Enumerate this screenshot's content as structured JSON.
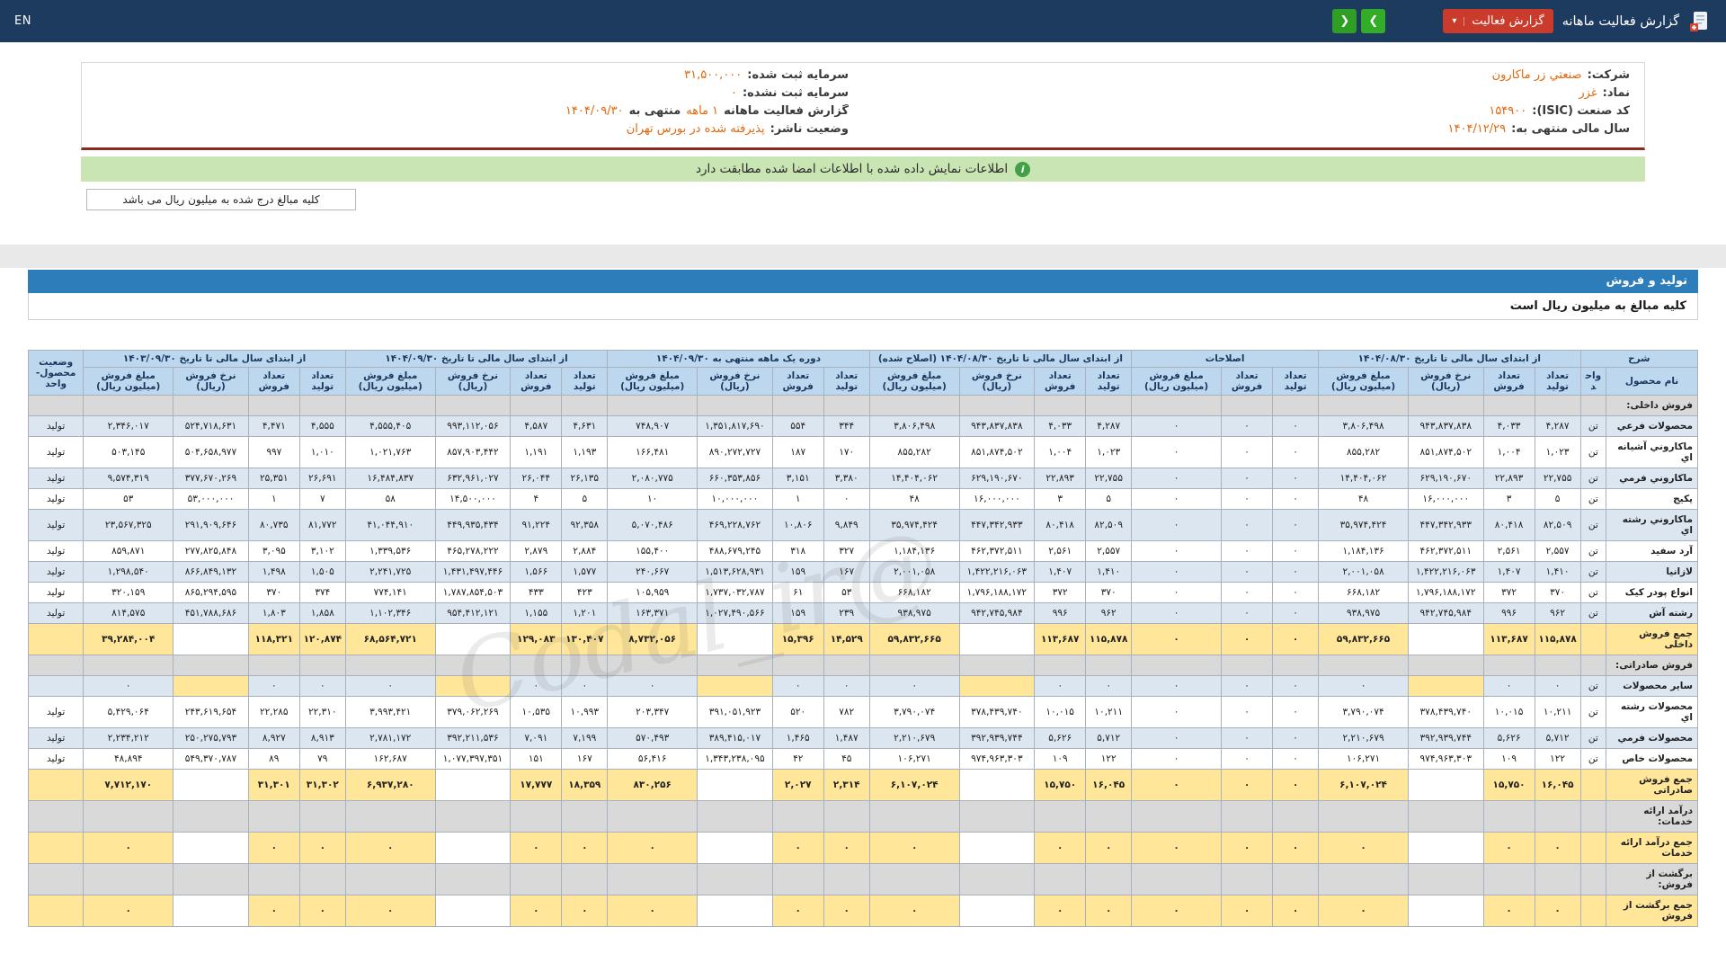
{
  "topbar": {
    "en_label": "EN",
    "title": "گزارش فعالیت ماهانه",
    "report_button_label": "گزارش فعالیت",
    "chevron_down_icon": "▾",
    "nav_forward_icon": "❯",
    "nav_back_icon": "❮"
  },
  "company_info": {
    "col_right": [
      {
        "label": "شرکت:",
        "value": "صنعتي زر ماکارون"
      },
      {
        "label": "نماد:",
        "value": "غزر"
      },
      {
        "label": "کد صنعت (ISIC):",
        "value": "۱۵۴۹۰۰"
      },
      {
        "label": "سال مالی منتهی به:",
        "value": "۱۴۰۴/۱۲/۲۹"
      }
    ],
    "col_left": [
      {
        "label": "سرمایه ثبت شده:",
        "value": "۳۱,۵۰۰,۰۰۰"
      },
      {
        "label": "سرمایه ثبت نشده:",
        "value": "۰"
      },
      {
        "label": "گزارش فعالیت ماهانه",
        "value": "۱ ماهه",
        "label2": "منتهی به",
        "value2": "۱۴۰۴/۰۹/۳۰"
      },
      {
        "label": "وضعیت ناشر:",
        "value": "پذيرفته شده در بورس تهران"
      }
    ]
  },
  "signature_banner": {
    "icon": "i",
    "text": "اطلاعات نمایش داده شده با اطلاعات امضا شده مطابقت دارد"
  },
  "amounts_note": "کلیه مبالغ درج شده به میلیون ریال می باشد",
  "production_section": {
    "title": "تولید و فروش",
    "note": "کلیه مبالغ به میلیون ریال است"
  },
  "watermark": "@Codal_ir",
  "colors": {
    "topbar_bg": "#1d3a5f",
    "accent_red": "#ca3b2b",
    "accent_green": "#33ad27",
    "value_orange": "#e2680c",
    "banner_green": "#c9e5b3",
    "maroon_line": "#8c2a21",
    "section_bar_blue": "#2d7dbb",
    "table_header_blue": "#bdd7ee",
    "stripe_blue": "#dce6f1",
    "total_yellow": "#ffe699",
    "section_gray": "#d9d9d9"
  },
  "table": {
    "sharh_label": "شرح",
    "status_label": "وضعیت محصول-واحد",
    "name_label": "نام محصول",
    "unit_label": "واحد",
    "col_labels": {
      "prod": "تعداد تولید",
      "sale": "تعداد فروش",
      "rate": "نرخ فروش (ریال)",
      "amt": "مبلغ فروش (میلیون ریال)"
    },
    "groups": [
      {
        "label": "از ابتدای سال مالی تا تاریخ ۱۴۰۴/۰۸/۳۰",
        "cols": [
          "prod",
          "sale",
          "rate",
          "amt"
        ]
      },
      {
        "label": "اصلاحات",
        "cols": [
          "prod",
          "sale",
          "amt"
        ]
      },
      {
        "label": "از ابتدای سال مالی تا تاریخ ۱۴۰۴/۰۸/۳۰ (اصلاح شده)",
        "cols": [
          "prod",
          "sale",
          "rate",
          "amt"
        ]
      },
      {
        "label": "دوره یک ماهه منتهی به ۱۴۰۴/۰۹/۳۰",
        "cols": [
          "prod",
          "sale",
          "rate",
          "amt"
        ]
      },
      {
        "label": "از ابتدای سال مالی تا تاریخ ۱۴۰۴/۰۹/۳۰",
        "cols": [
          "prod",
          "sale",
          "rate",
          "amt"
        ]
      },
      {
        "label": "از ابتدای سال مالی تا تاریخ ۱۴۰۳/۰۹/۳۰",
        "cols": [
          "prod",
          "sale",
          "rate",
          "amt"
        ]
      }
    ],
    "rows": [
      {
        "type": "section",
        "label": "فروش داخلی:"
      },
      {
        "type": "data",
        "stripe": true,
        "cells": [
          "محصولات فرعي",
          "تن",
          "۴,۲۸۷",
          "۴,۰۳۳",
          "۹۴۳,۸۳۷,۸۳۸",
          "۳,۸۰۶,۴۹۸",
          "۰",
          "۰",
          "۰",
          "۴,۲۸۷",
          "۴,۰۳۳",
          "۹۴۳,۸۳۷,۸۳۸",
          "۳,۸۰۶,۴۹۸",
          "۳۴۴",
          "۵۵۴",
          "۱,۳۵۱,۸۱۷,۶۹۰",
          "۷۴۸,۹۰۷",
          "۴,۶۳۱",
          "۴,۵۸۷",
          "۹۹۳,۱۱۲,۰۵۶",
          "۴,۵۵۵,۴۰۵",
          "۴,۵۵۵",
          "۴,۴۷۱",
          "۵۲۴,۷۱۸,۶۳۱",
          "۲,۳۴۶,۰۱۷",
          "تولید"
        ]
      },
      {
        "type": "data",
        "cells": [
          "ماکاروني آشيانه اي",
          "تن",
          "۱,۰۲۳",
          "۱,۰۰۴",
          "۸۵۱,۸۷۴,۵۰۲",
          "۸۵۵,۲۸۲",
          "۰",
          "۰",
          "۰",
          "۱,۰۲۳",
          "۱,۰۰۴",
          "۸۵۱,۸۷۴,۵۰۲",
          "۸۵۵,۲۸۲",
          "۱۷۰",
          "۱۸۷",
          "۸۹۰,۲۷۲,۷۲۷",
          "۱۶۶,۴۸۱",
          "۱,۱۹۳",
          "۱,۱۹۱",
          "۸۵۷,۹۰۳,۴۴۲",
          "۱,۰۲۱,۷۶۳",
          "۱,۰۱۰",
          "۹۹۷",
          "۵۰۴,۶۵۸,۹۷۷",
          "۵۰۳,۱۴۵",
          "تولید"
        ]
      },
      {
        "type": "data",
        "stripe": true,
        "cells": [
          "ماکاروني فرمي",
          "تن",
          "۲۲,۷۵۵",
          "۲۲,۸۹۳",
          "۶۲۹,۱۹۰,۶۷۰",
          "۱۴,۴۰۴,۰۶۲",
          "۰",
          "۰",
          "۰",
          "۲۲,۷۵۵",
          "۲۲,۸۹۳",
          "۶۲۹,۱۹۰,۶۷۰",
          "۱۴,۴۰۴,۰۶۲",
          "۳,۳۸۰",
          "۳,۱۵۱",
          "۶۶۰,۳۵۳,۸۵۶",
          "۲,۰۸۰,۷۷۵",
          "۲۶,۱۳۵",
          "۲۶,۰۴۴",
          "۶۳۲,۹۶۱,۰۲۷",
          "۱۶,۴۸۴,۸۳۷",
          "۲۶,۶۹۱",
          "۲۵,۳۵۱",
          "۳۷۷,۶۷۰,۲۶۹",
          "۹,۵۷۴,۳۱۹",
          "تولید"
        ]
      },
      {
        "type": "data",
        "cells": [
          "پکيج",
          "تن",
          "۵",
          "۳",
          "۱۶,۰۰۰,۰۰۰",
          "۴۸",
          "۰",
          "۰",
          "۰",
          "۵",
          "۳",
          "۱۶,۰۰۰,۰۰۰",
          "۴۸",
          "۰",
          "۱",
          "۱۰,۰۰۰,۰۰۰",
          "۱۰",
          "۵",
          "۴",
          "۱۴,۵۰۰,۰۰۰",
          "۵۸",
          "۷",
          "۱",
          "۵۳,۰۰۰,۰۰۰",
          "۵۳",
          "تولید"
        ]
      },
      {
        "type": "data",
        "stripe": true,
        "cells": [
          "ماکاروني رشته اي",
          "تن",
          "۸۲,۵۰۹",
          "۸۰,۴۱۸",
          "۴۴۷,۳۴۲,۹۳۳",
          "۳۵,۹۷۴,۴۲۴",
          "۰",
          "۰",
          "۰",
          "۸۲,۵۰۹",
          "۸۰,۴۱۸",
          "۴۴۷,۳۴۲,۹۳۳",
          "۳۵,۹۷۴,۴۲۴",
          "۹,۸۴۹",
          "۱۰,۸۰۶",
          "۴۶۹,۲۲۸,۷۶۲",
          "۵,۰۷۰,۴۸۶",
          "۹۲,۳۵۸",
          "۹۱,۲۲۴",
          "۴۴۹,۹۳۵,۴۳۴",
          "۴۱,۰۴۴,۹۱۰",
          "۸۱,۷۷۲",
          "۸۰,۷۳۵",
          "۲۹۱,۹۰۹,۶۴۶",
          "۲۳,۵۶۷,۳۲۵",
          "تولید"
        ]
      },
      {
        "type": "data",
        "cells": [
          "آرد سفيد",
          "تن",
          "۲,۵۵۷",
          "۲,۵۶۱",
          "۴۶۲,۳۷۲,۵۱۱",
          "۱,۱۸۴,۱۳۶",
          "۰",
          "۰",
          "۰",
          "۲,۵۵۷",
          "۲,۵۶۱",
          "۴۶۲,۳۷۲,۵۱۱",
          "۱,۱۸۴,۱۳۶",
          "۳۲۷",
          "۳۱۸",
          "۴۸۸,۶۷۹,۲۴۵",
          "۱۵۵,۴۰۰",
          "۲,۸۸۴",
          "۲,۸۷۹",
          "۴۶۵,۲۷۸,۲۲۲",
          "۱,۳۳۹,۵۳۶",
          "۳,۱۰۲",
          "۳,۰۹۵",
          "۲۷۷,۸۲۵,۸۴۸",
          "۸۵۹,۸۷۱",
          "تولید"
        ]
      },
      {
        "type": "data",
        "stripe": true,
        "cells": [
          "لازانيا",
          "تن",
          "۱,۴۱۰",
          "۱,۴۰۷",
          "۱,۴۲۲,۲۱۶,۰۶۳",
          "۲,۰۰۱,۰۵۸",
          "۰",
          "۰",
          "۰",
          "۱,۴۱۰",
          "۱,۴۰۷",
          "۱,۴۲۲,۲۱۶,۰۶۳",
          "۲,۰۰۱,۰۵۸",
          "۱۶۷",
          "۱۵۹",
          "۱,۵۱۳,۶۲۸,۹۳۱",
          "۲۴۰,۶۶۷",
          "۱,۵۷۷",
          "۱,۵۶۶",
          "۱,۴۳۱,۴۹۷,۴۴۶",
          "۲,۲۴۱,۷۲۵",
          "۱,۵۰۵",
          "۱,۴۹۸",
          "۸۶۶,۸۴۹,۱۳۲",
          "۱,۲۹۸,۵۴۰",
          "تولید"
        ]
      },
      {
        "type": "data",
        "cells": [
          "انواع پودر کيک",
          "تن",
          "۳۷۰",
          "۳۷۲",
          "۱,۷۹۶,۱۸۸,۱۷۲",
          "۶۶۸,۱۸۲",
          "۰",
          "۰",
          "۰",
          "۳۷۰",
          "۳۷۲",
          "۱,۷۹۶,۱۸۸,۱۷۲",
          "۶۶۸,۱۸۲",
          "۵۳",
          "۶۱",
          "۱,۷۳۷,۰۳۲,۷۸۷",
          "۱۰۵,۹۵۹",
          "۴۲۳",
          "۴۳۳",
          "۱,۷۸۷,۸۵۴,۵۰۳",
          "۷۷۴,۱۴۱",
          "۳۷۴",
          "۳۷۰",
          "۸۶۵,۲۹۴,۵۹۵",
          "۳۲۰,۱۵۹",
          "تولید"
        ]
      },
      {
        "type": "data",
        "stripe": true,
        "cells": [
          "رشته آش",
          "تن",
          "۹۶۲",
          "۹۹۶",
          "۹۴۲,۷۴۵,۹۸۴",
          "۹۳۸,۹۷۵",
          "۰",
          "۰",
          "۰",
          "۹۶۲",
          "۹۹۶",
          "۹۴۲,۷۴۵,۹۸۴",
          "۹۳۸,۹۷۵",
          "۲۳۹",
          "۱۵۹",
          "۱,۰۲۷,۴۹۰,۵۶۶",
          "۱۶۳,۳۷۱",
          "۱,۲۰۱",
          "۱,۱۵۵",
          "۹۵۴,۴۱۲,۱۲۱",
          "۱,۱۰۲,۳۴۶",
          "۱,۸۵۸",
          "۱,۸۰۳",
          "۴۵۱,۷۸۸,۶۸۶",
          "۸۱۴,۵۷۵",
          "تولید"
        ]
      },
      {
        "type": "total",
        "rate_bg": "white",
        "cells": [
          "جمع فروش داخلی",
          "",
          "۱۱۵,۸۷۸",
          "۱۱۳,۶۸۷",
          "",
          "۵۹,۸۳۲,۶۶۵",
          "۰",
          "۰",
          "۰",
          "۱۱۵,۸۷۸",
          "۱۱۳,۶۸۷",
          "",
          "۵۹,۸۳۲,۶۶۵",
          "۱۴,۵۲۹",
          "۱۵,۳۹۶",
          "",
          "۸,۷۳۲,۰۵۶",
          "۱۳۰,۴۰۷",
          "۱۲۹,۰۸۳",
          "",
          "۶۸,۵۶۴,۷۲۱",
          "۱۲۰,۸۷۴",
          "۱۱۸,۳۲۱",
          "",
          "۳۹,۲۸۴,۰۰۴",
          ""
        ]
      },
      {
        "type": "section",
        "label": "فروش صادراتی:"
      },
      {
        "type": "data",
        "stripe": true,
        "rate_bg": "yellow",
        "cells": [
          "ساير محصولات",
          "تن",
          "۰",
          "۰",
          "",
          "۰",
          "۰",
          "۰",
          "۰",
          "۰",
          "۰",
          "",
          "۰",
          "۰",
          "۰",
          "",
          "۰",
          "۰",
          "۰",
          "",
          "۰",
          "۰",
          "۰",
          "",
          "۰",
          ""
        ]
      },
      {
        "type": "data",
        "cells": [
          "محصولات رشته اي",
          "تن",
          "۱۰,۲۱۱",
          "۱۰,۰۱۵",
          "۳۷۸,۴۳۹,۷۴۰",
          "۳,۷۹۰,۰۷۴",
          "۰",
          "۰",
          "۰",
          "۱۰,۲۱۱",
          "۱۰,۰۱۵",
          "۳۷۸,۴۳۹,۷۴۰",
          "۳,۷۹۰,۰۷۴",
          "۷۸۲",
          "۵۲۰",
          "۳۹۱,۰۵۱,۹۲۳",
          "۲۰۳,۳۴۷",
          "۱۰,۹۹۳",
          "۱۰,۵۳۵",
          "۳۷۹,۰۶۲,۲۶۹",
          "۳,۹۹۳,۴۲۱",
          "۲۲,۳۱۰",
          "۲۲,۲۸۵",
          "۲۴۳,۶۱۹,۶۵۴",
          "۵,۴۲۹,۰۶۴",
          "تولید"
        ]
      },
      {
        "type": "data",
        "stripe": true,
        "cells": [
          "محصولات فرمي",
          "تن",
          "۵,۷۱۲",
          "۵,۶۲۶",
          "۳۹۲,۹۳۹,۷۴۴",
          "۲,۲۱۰,۶۷۹",
          "۰",
          "۰",
          "۰",
          "۵,۷۱۲",
          "۵,۶۲۶",
          "۳۹۲,۹۳۹,۷۴۴",
          "۲,۲۱۰,۶۷۹",
          "۱,۴۸۷",
          "۱,۴۶۵",
          "۳۸۹,۴۱۵,۰۱۷",
          "۵۷۰,۴۹۳",
          "۷,۱۹۹",
          "۷,۰۹۱",
          "۳۹۲,۲۱۱,۵۳۶",
          "۲,۷۸۱,۱۷۲",
          "۸,۹۱۳",
          "۸,۹۲۷",
          "۲۵۰,۲۷۵,۷۹۳",
          "۲,۲۳۴,۲۱۲",
          "تولید"
        ]
      },
      {
        "type": "data",
        "cells": [
          "محصولات خاص",
          "تن",
          "۱۲۲",
          "۱۰۹",
          "۹۷۴,۹۶۳,۳۰۳",
          "۱۰۶,۲۷۱",
          "۰",
          "۰",
          "۰",
          "۱۲۲",
          "۱۰۹",
          "۹۷۴,۹۶۳,۳۰۳",
          "۱۰۶,۲۷۱",
          "۴۵",
          "۴۲",
          "۱,۳۴۳,۲۳۸,۰۹۵",
          "۵۶,۴۱۶",
          "۱۶۷",
          "۱۵۱",
          "۱,۰۷۷,۳۹۷,۳۵۱",
          "۱۶۲,۶۸۷",
          "۷۹",
          "۸۹",
          "۵۴۹,۳۷۰,۷۸۷",
          "۴۸,۸۹۴",
          "تولید"
        ]
      },
      {
        "type": "total",
        "rate_bg": "white",
        "cells": [
          "جمع فروش صادراتی",
          "",
          "۱۶,۰۴۵",
          "۱۵,۷۵۰",
          "",
          "۶,۱۰۷,۰۲۴",
          "۰",
          "۰",
          "۰",
          "۱۶,۰۴۵",
          "۱۵,۷۵۰",
          "",
          "۶,۱۰۷,۰۲۴",
          "۲,۳۱۴",
          "۲,۰۲۷",
          "",
          "۸۳۰,۲۵۶",
          "۱۸,۳۵۹",
          "۱۷,۷۷۷",
          "",
          "۶,۹۳۷,۲۸۰",
          "۳۱,۳۰۲",
          "۳۱,۳۰۱",
          "",
          "۷,۷۱۲,۱۷۰",
          ""
        ]
      },
      {
        "type": "section",
        "label": "درآمد ارائه خدمات:"
      },
      {
        "type": "total",
        "rate_bg": "white",
        "cells": [
          "جمع درآمد ارائه خدمات",
          "",
          "۰",
          "۰",
          "",
          "۰",
          "۰",
          "۰",
          "۰",
          "۰",
          "۰",
          "",
          "۰",
          "۰",
          "۰",
          "",
          "۰",
          "۰",
          "۰",
          "",
          "۰",
          "۰",
          "۰",
          "",
          "۰",
          ""
        ]
      },
      {
        "type": "section",
        "label": "برگشت از فروش:"
      },
      {
        "type": "total",
        "rate_bg": "white",
        "cells": [
          "جمع برگشت از فروش",
          "",
          "۰",
          "۰",
          "",
          "۰",
          "۰",
          "۰",
          "۰",
          "۰",
          "۰",
          "",
          "۰",
          "۰",
          "۰",
          "",
          "۰",
          "۰",
          "۰",
          "",
          "۰",
          "۰",
          "۰",
          "",
          "۰",
          ""
        ]
      }
    ]
  }
}
